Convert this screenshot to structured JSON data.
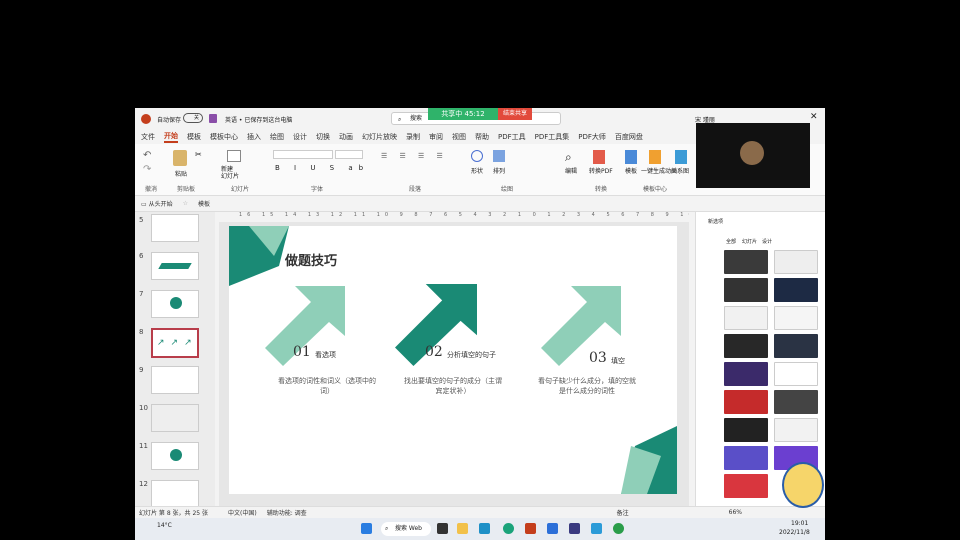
{
  "share_bar": {
    "share_status": "共享中 45:12",
    "end_share": "结束共享"
  },
  "titlebar": {
    "autosave": "自动保存",
    "toggle": "关",
    "doc_title": "英语 • 已保存到这台电脑",
    "search": "搜索",
    "user": "宋 瑾丽"
  },
  "menu": [
    "文件",
    "开始",
    "模板",
    "模板中心",
    "插入",
    "绘图",
    "设计",
    "切换",
    "动画",
    "幻灯片放映",
    "录制",
    "审阅",
    "视图",
    "帮助",
    "PDF工具",
    "PDF工具集",
    "PDF大师",
    "百度网盘"
  ],
  "ribbon": {
    "paste": "粘贴",
    "new_slide": "新建\n幻灯片",
    "shape": "形状",
    "arrange": "排列",
    "find": "编辑",
    "convert": "转换PDF",
    "template": "模板",
    "combo": "一键生成动画",
    "relation": "关系图",
    "groups": [
      "撤消",
      "剪贴板",
      "幻灯片",
      "字体",
      "段落",
      "绘图",
      "转换",
      "模板中心"
    ]
  },
  "quickaccess": {
    "from_start": "从头开始",
    "template": "模板"
  },
  "thumbnails": [
    {
      "num": "5"
    },
    {
      "num": "6"
    },
    {
      "num": "7"
    },
    {
      "num": "8"
    },
    {
      "num": "9"
    },
    {
      "num": "10"
    },
    {
      "num": "11"
    },
    {
      "num": "12"
    }
  ],
  "ruler": "16 15 14 13 12 11 10 9 8 7 6 5 4 3 2 1 0 1 2 3 4 5 6 7 8 9 10 11 12 13 14 15 16",
  "slide": {
    "title": "做题技巧",
    "items": [
      {
        "num": "01",
        "label": "看选项",
        "desc": "看选项的词性和词义（选项中的词）"
      },
      {
        "num": "02",
        "label": "分析填空的句子",
        "desc": "找出要填空的句子的成分（主谓宾定状补）"
      },
      {
        "num": "03",
        "label": "填空",
        "desc": "看句子缺少什么成分，填的空就是什么成分的词性"
      }
    ]
  },
  "right_panel": {
    "title": "新选项",
    "tabs": [
      "全部",
      "幻灯片",
      "设计"
    ]
  },
  "statusbar": {
    "slide_info": "幻灯片 第 8 张，共 25 张",
    "lang": "中文(中国)",
    "accessibility": "辅助功能: 调查",
    "notes": "备注",
    "zoom": "66%"
  },
  "taskbar": {
    "weather": "14°C",
    "search": "搜索 Web",
    "time": "19:01",
    "date": "2022/11/8"
  },
  "colors": {
    "accent": "#c43e1c",
    "teal_dark": "#1a8a75",
    "teal_light": "#8fcfb8",
    "share_green": "#2fb36a",
    "end_red": "#e24a3b"
  }
}
